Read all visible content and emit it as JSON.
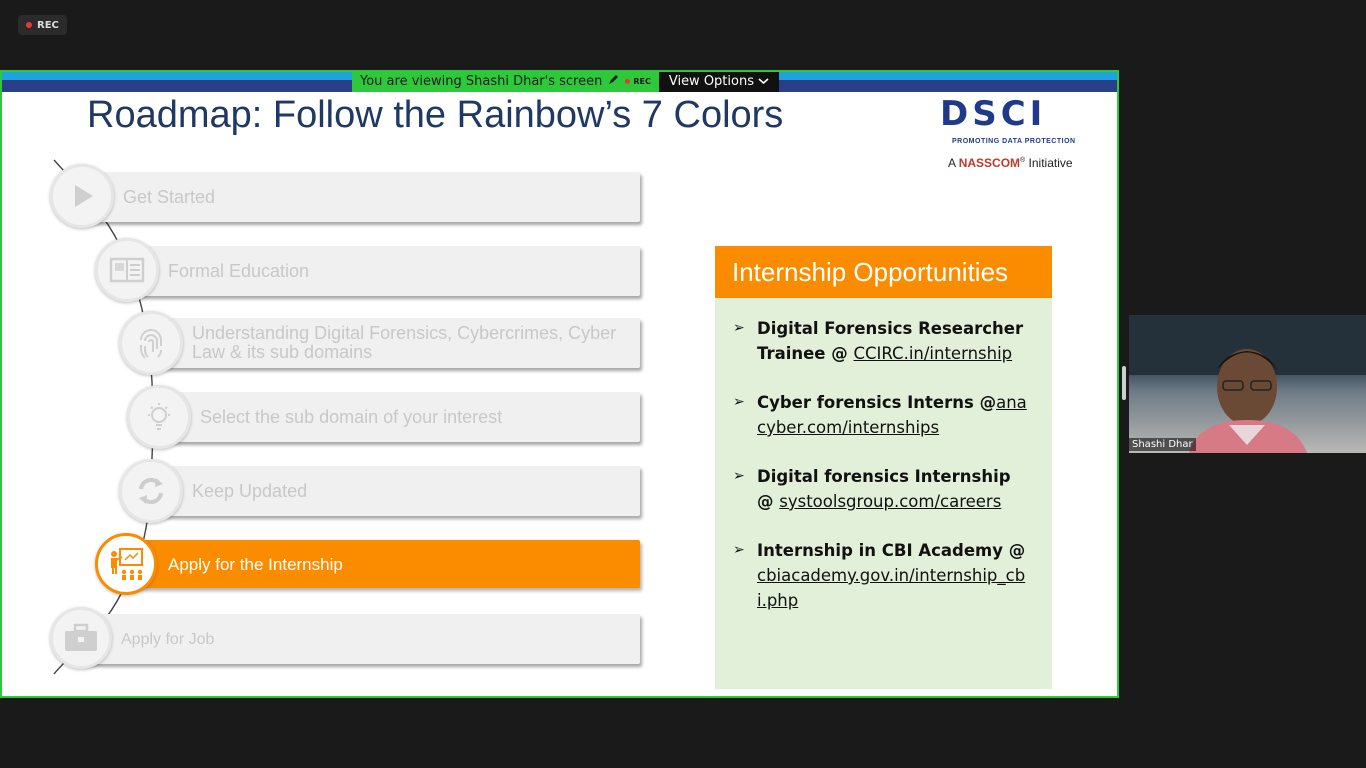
{
  "recording": {
    "label": "REC"
  },
  "share_banner": {
    "message": "You are viewing Shashi Dhar's screen",
    "rec_label": "REC",
    "view_options_label": "View Options"
  },
  "slide": {
    "title": "Roadmap: Follow the Rainbow’s 7 Colors",
    "logo": {
      "wordmark": "DSCI",
      "tagline": "PROMOTING DATA PROTECTION",
      "initiative_prefix": "A",
      "initiative_brand": "NASSCOM",
      "initiative_reg": "®",
      "initiative_suffix": "Initiative"
    },
    "steps": [
      {
        "label": "Get Started",
        "icon": "play-icon"
      },
      {
        "label": "Formal Education",
        "icon": "book-icon"
      },
      {
        "label": "Understanding Digital Forensics, Cybercrimes, Cyber Law & its sub domains",
        "icon": "fingerprint-icon"
      },
      {
        "label": "Select the sub domain of your interest",
        "icon": "lightbulb-icon"
      },
      {
        "label": "Keep Updated",
        "icon": "refresh-icon"
      },
      {
        "label": "Apply for the Internship",
        "icon": "presentation-icon"
      },
      {
        "label": "Apply for Job",
        "icon": "briefcase-icon"
      }
    ],
    "active_step": 5,
    "internship": {
      "header": "Internship Opportunities",
      "items": [
        {
          "bold": "Digital Forensics Researcher Trainee @ ",
          "link": "CCIRC.in/internship"
        },
        {
          "bold": "Cyber forensics Interns @",
          "link": "anacyber.com/internships"
        },
        {
          "bold": "Digital forensics Internship @ ",
          "link": "systoolsgroup.com/careers"
        },
        {
          "bold": "Internship in CBI Academy @ ",
          "link": "cbiacademy.gov.in/internship_cbi.php"
        }
      ]
    }
  },
  "participant": {
    "name": "Shashi Dhar"
  },
  "colors": {
    "accent_orange": "#fb8c00",
    "share_green": "#2ec93a",
    "title_navy": "#1f3864",
    "panel_green": "#e2efd9"
  }
}
